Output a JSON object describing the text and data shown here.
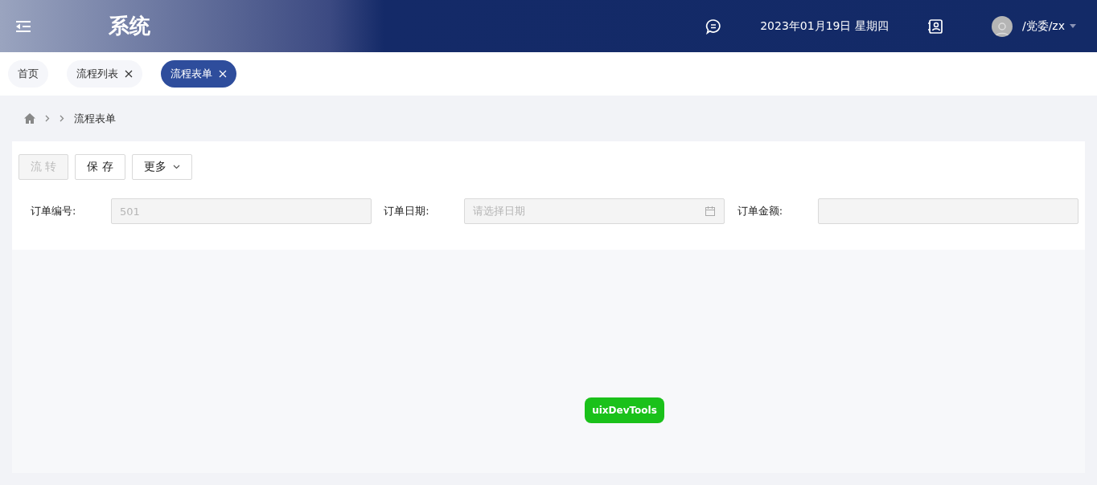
{
  "header": {
    "title": "系统",
    "date": "2023年01月19日 星期四",
    "user": "/党委/zx"
  },
  "tabs": [
    {
      "label": "首页",
      "selected": false,
      "closable": false
    },
    {
      "label": "流程列表",
      "selected": false,
      "closable": true
    },
    {
      "label": "流程表单",
      "selected": true,
      "closable": true
    }
  ],
  "breadcrumb": [
    {
      "kind": "blank"
    },
    {
      "kind": "text",
      "label": "流程表单"
    }
  ],
  "toolbar": [
    {
      "label": "流 转",
      "disabled": true,
      "kind": "plain"
    },
    {
      "label": "保 存",
      "disabled": false,
      "kind": "plain"
    },
    {
      "label": "更多",
      "disabled": false,
      "kind": "dropdown"
    }
  ],
  "form": [
    {
      "label": "订单编号:",
      "kind": "text",
      "value": "501"
    },
    {
      "label": "订单日期:",
      "kind": "date",
      "placeholder": "请选择日期"
    },
    {
      "label": "订单金额:",
      "kind": "text"
    }
  ],
  "devtools_button": "uixDevTools"
}
